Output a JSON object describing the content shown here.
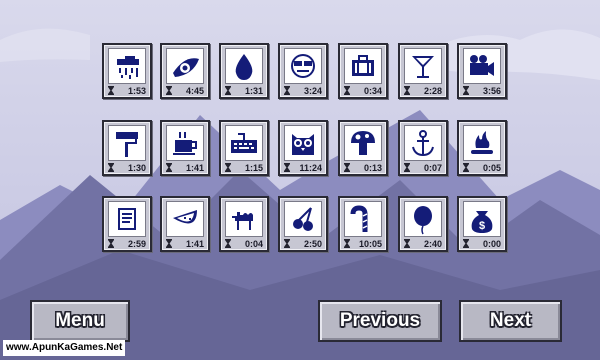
{
  "puzzles": [
    {
      "icon": "storm-cloud-icon",
      "time": "1:53"
    },
    {
      "icon": "leaf-swirl-icon",
      "time": "4:45"
    },
    {
      "icon": "water-drop-icon",
      "time": "1:31"
    },
    {
      "icon": "face-with-glasses-icon",
      "time": "3:24"
    },
    {
      "icon": "suitcase-icon",
      "time": "0:34"
    },
    {
      "icon": "cocktail-glass-icon",
      "time": "2:28"
    },
    {
      "icon": "film-camera-icon",
      "time": "3:56"
    },
    {
      "icon": "paint-roller-icon",
      "time": "1:30"
    },
    {
      "icon": "coffee-cup-icon",
      "time": "1:41"
    },
    {
      "icon": "keyboard-icon",
      "time": "1:15"
    },
    {
      "icon": "owl-icon",
      "time": "11:24"
    },
    {
      "icon": "mushroom-icon",
      "time": "0:13"
    },
    {
      "icon": "anchor-icon",
      "time": "0:07"
    },
    {
      "icon": "campfire-icon",
      "time": "0:05"
    },
    {
      "icon": "scroll-icon",
      "time": "2:59"
    },
    {
      "icon": "watermelon-slice-icon",
      "time": "1:41"
    },
    {
      "icon": "camel-icon",
      "time": "0:04"
    },
    {
      "icon": "cherries-icon",
      "time": "2:50"
    },
    {
      "icon": "candy-cane-icon",
      "time": "10:05"
    },
    {
      "icon": "balloon-icon",
      "time": "2:40"
    },
    {
      "icon": "money-bag-icon",
      "time": "0:00"
    }
  ],
  "buttons": {
    "menu": "Menu",
    "previous": "Previous",
    "next": "Next"
  },
  "watermark": "www.ApunKaGames.Net",
  "colors": {
    "sky_top": "#d9d9ec",
    "sky_bottom": "#c1c1df",
    "mountain_back": "#8c8cbf",
    "mountain_front": "#7272a4",
    "tile_bg": "#c7c7d3",
    "pixel_art": "#141c78"
  }
}
